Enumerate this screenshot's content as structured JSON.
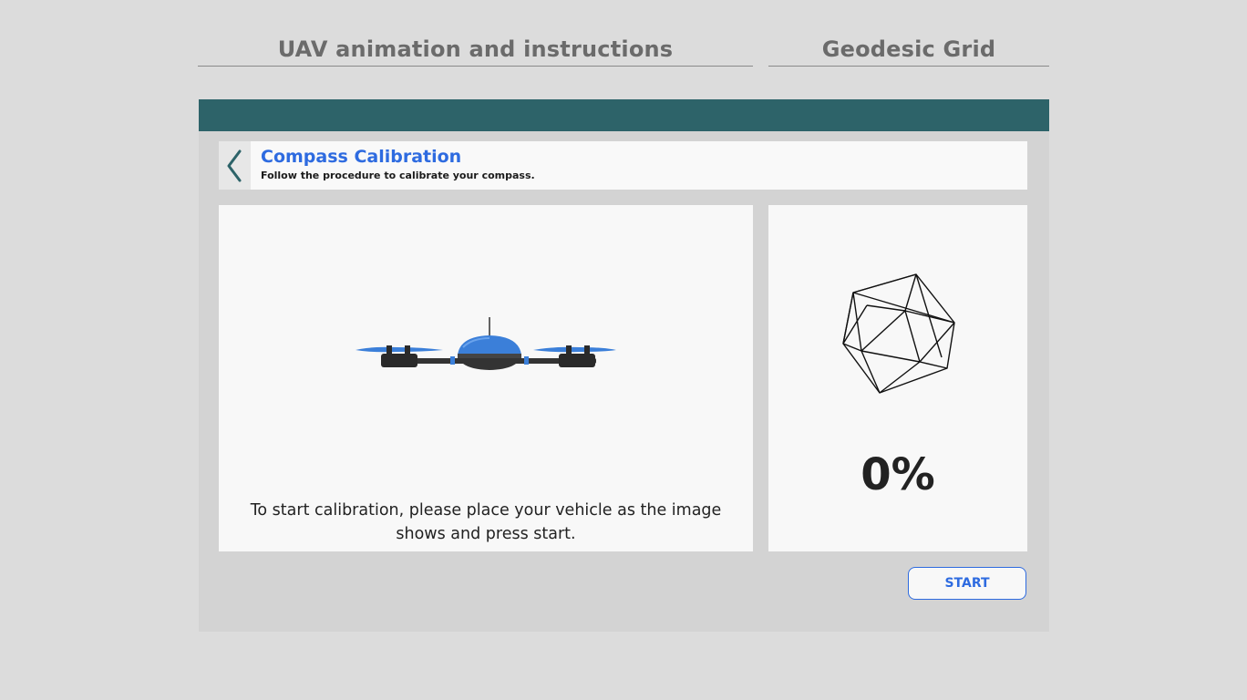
{
  "headings": {
    "left": "UAV animation and instructions",
    "right": "Geodesic Grid"
  },
  "calibration": {
    "title": "Compass Calibration",
    "subtitle": "Follow the procedure to calibrate your compass.",
    "instruction": "To start calibration, please place your vehicle as the image shows and press start.",
    "progress_percent": 0,
    "progress_label": "0%",
    "start_label": "START"
  },
  "icons": {
    "back": "chevron-left-icon",
    "drone": "drone-image",
    "grid": "geodesic-grid-icon"
  },
  "colors": {
    "accent": "#2e6be0",
    "topbar": "#2d6369",
    "drone_body": "#3b7fd9",
    "page_bg": "#dcdcdc"
  }
}
